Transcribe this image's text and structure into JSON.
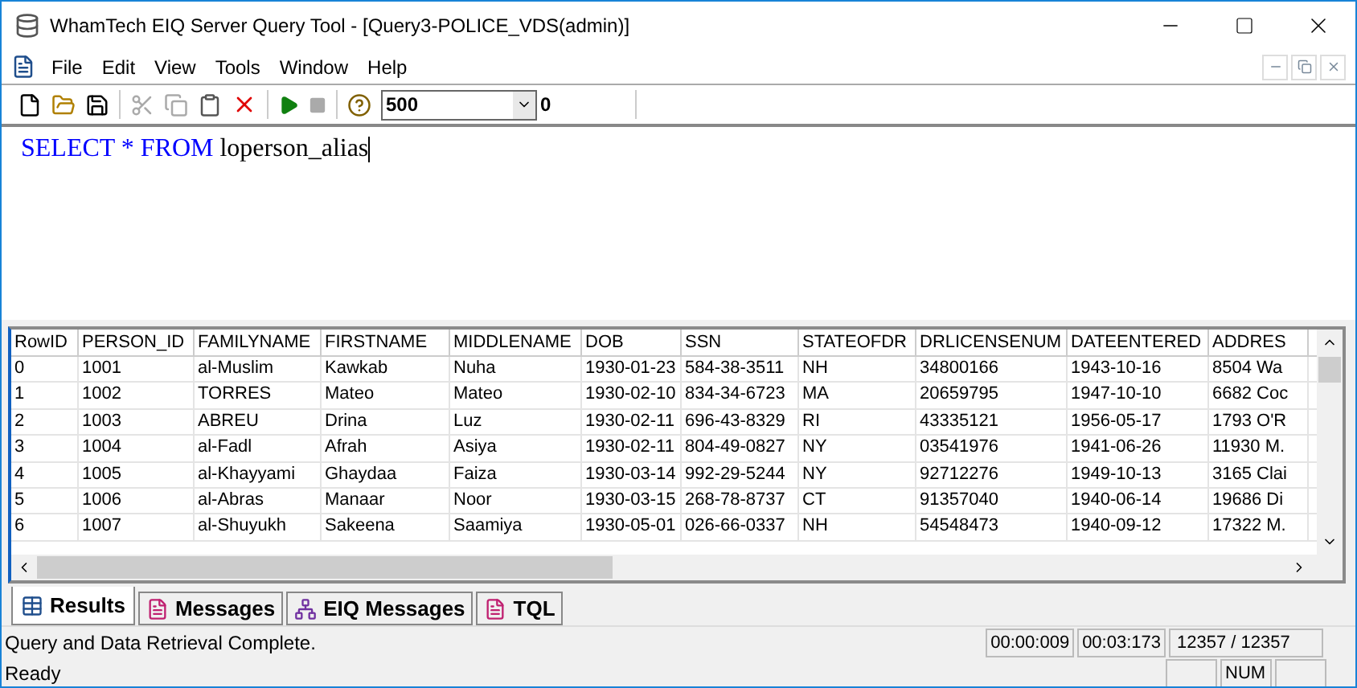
{
  "window": {
    "title": "WhamTech EIQ Server Query Tool - [Query3-POLICE_VDS(admin)]"
  },
  "menu": [
    "File",
    "Edit",
    "View",
    "Tools",
    "Window",
    "Help"
  ],
  "toolbar": {
    "row_limit": "500",
    "count": "0"
  },
  "query": {
    "keywords": [
      "SELECT",
      "*",
      "FROM"
    ],
    "table": "loperson_alias"
  },
  "table": {
    "columns": [
      "RowID",
      "PERSON_ID",
      "FAMILYNAME",
      "FIRSTNAME",
      "MIDDLENAME",
      "DOB",
      "SSN",
      "STATEOFDR",
      "DRLICENSENUM",
      "DATEENTERED",
      "ADDRES"
    ],
    "rows": [
      [
        "0",
        "1001",
        "al-Muslim",
        "Kawkab",
        "Nuha",
        "1930-01-23",
        "584-38-3511",
        "NH",
        "34800166",
        "1943-10-16",
        "8504 Wa"
      ],
      [
        "1",
        "1002",
        "TORRES",
        "Mateo",
        "Mateo",
        "1930-02-10",
        "834-34-6723",
        "MA",
        "20659795",
        "1947-10-10",
        "6682 Coc"
      ],
      [
        "2",
        "1003",
        "ABREU",
        "Drina",
        "Luz",
        "1930-02-11",
        "696-43-8329",
        "RI",
        "43335121",
        "1956-05-17",
        "1793 O'R"
      ],
      [
        "3",
        "1004",
        "al-Fadl",
        "Afrah",
        "Asiya",
        "1930-02-11",
        "804-49-0827",
        "NY",
        "03541976",
        "1941-06-26",
        "11930 M."
      ],
      [
        "4",
        "1005",
        "al-Khayyami",
        "Ghaydaa",
        "Faiza",
        "1930-03-14",
        "992-29-5244",
        "NY",
        "92712276",
        "1949-10-13",
        "3165 Clai"
      ],
      [
        "5",
        "1006",
        "al-Abras",
        "Manaar",
        "Noor",
        "1930-03-15",
        "268-78-8737",
        "CT",
        "91357040",
        "1940-06-14",
        "19686 Di"
      ],
      [
        "6",
        "1007",
        "al-Shuyukh",
        "Sakeena",
        "Saamiya",
        "1930-05-01",
        "026-66-0337",
        "NH",
        "54548473",
        "1940-09-12",
        "17322 M."
      ]
    ]
  },
  "tabs": [
    {
      "label": "Results",
      "selected": true,
      "kind": "grid"
    },
    {
      "label": "Messages",
      "selected": false,
      "kind": "messages"
    },
    {
      "label": "EIQ Messages",
      "selected": false,
      "kind": "eiq"
    },
    {
      "label": "TQL",
      "selected": false,
      "kind": "messages"
    }
  ],
  "status_bar": {
    "message": "Query and Data Retrieval Complete.",
    "timers": [
      "00:00:009",
      "00:03:173"
    ],
    "rows": "12357 / 12357",
    "state": "Ready",
    "indicator": "NUM"
  }
}
